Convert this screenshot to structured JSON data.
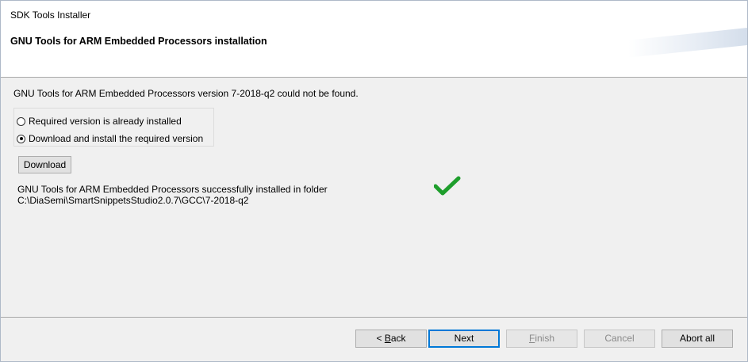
{
  "window": {
    "title": "SDK Tools Installer"
  },
  "banner": {
    "heading": "GNU Tools for ARM Embedded Processors installation"
  },
  "main": {
    "message": "GNU Tools for ARM Embedded Processors version 7-2018-q2 could not be found.",
    "options": [
      {
        "label": "Required version is already installed",
        "checked": false
      },
      {
        "label": "Download and install the required version",
        "checked": true
      }
    ],
    "download_label": "Download",
    "status_line1": "GNU Tools for ARM Embedded Processors successfully installed in folder",
    "status_line2": "C:\\DiaSemi\\SmartSnippetsStudio2.0.7\\GCC\\7-2018-q2",
    "status_icon": "checkmark-icon",
    "status_color": "#1e9e2c"
  },
  "footer": {
    "back_prefix": "< ",
    "back_mnemonic": "B",
    "back_rest": "ack",
    "next_label": "Next",
    "finish_mnemonic": "F",
    "finish_rest": "inish",
    "cancel_label": "Cancel",
    "abort_label": "Abort all"
  }
}
